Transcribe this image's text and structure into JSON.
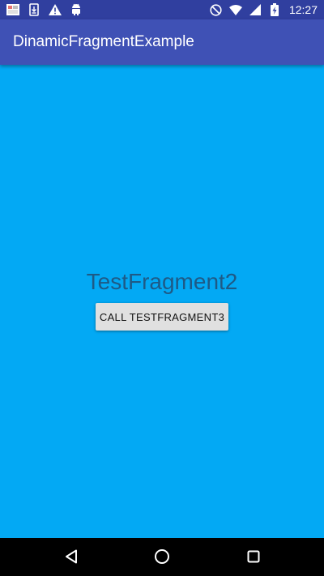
{
  "status_bar": {
    "time": "12:27",
    "left_icons": [
      "gallery-icon",
      "download-icon",
      "warning-icon",
      "android-icon"
    ],
    "right_icons": [
      "do-not-disturb-icon",
      "wifi-icon",
      "signal-icon",
      "battery-charging-icon"
    ]
  },
  "app_bar": {
    "title": "DinamicFragmentExample"
  },
  "fragment": {
    "title": "TestFragment2",
    "button_label": "CALL TESTFRAGMENT3"
  },
  "nav_bar": {
    "buttons": [
      "back-icon",
      "home-icon",
      "recents-icon"
    ]
  },
  "colors": {
    "status_bar": "#303F9F",
    "app_bar": "#3F51B5",
    "background": "#03A9F4",
    "title_text": "#1E5A86",
    "button_bg": "#E0E0E0",
    "nav_bar": "#000000"
  }
}
